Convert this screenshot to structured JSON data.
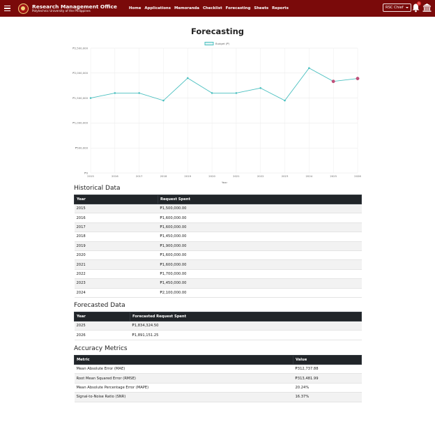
{
  "navbar": {
    "brand_title": "Research Management Office",
    "brand_subtitle": "Polytechnic University of the Philippines",
    "links": [
      "Home",
      "Applications",
      "Memoranda",
      "Checklist",
      "Forecasting",
      "Sheets",
      "Reports"
    ],
    "role": "RSC Chief",
    "notification_count": "1",
    "icons": [
      "menu-icon",
      "university-logo",
      "bell-icon",
      "building-icon"
    ]
  },
  "page": {
    "title": "Forecasting"
  },
  "chart_data": {
    "type": "line",
    "x": [
      "2015",
      "2016",
      "2017",
      "2018",
      "2019",
      "2020",
      "2021",
      "2022",
      "2023",
      "2024",
      "2025",
      "2026"
    ],
    "series": [
      {
        "name": "Budget (₱)",
        "values": [
          1500000,
          1600000,
          1600000,
          1450000,
          1900000,
          1600000,
          1600000,
          1700000,
          1450000,
          2100000,
          1834324.5,
          1891151.25
        ],
        "color": "#4bc0c0",
        "forecast_point_color": "#c0507a"
      }
    ],
    "ylim": [
      0,
      2500000
    ],
    "yticks": [
      "₱0",
      "₱500,000",
      "₱1,000,000",
      "₱1,500,000",
      "₱2,000,000",
      "₱2,500,000"
    ],
    "xlabel": "Year",
    "ylabel": "",
    "grid": true,
    "legend": "top-center"
  },
  "historical": {
    "title": "Historical Data",
    "headers": [
      "Year",
      "Request Spent"
    ],
    "rows": [
      [
        "2015",
        "₱1,500,000.00"
      ],
      [
        "2016",
        "₱1,600,000.00"
      ],
      [
        "2017",
        "₱1,600,000.00"
      ],
      [
        "2018",
        "₱1,450,000.00"
      ],
      [
        "2019",
        "₱1,900,000.00"
      ],
      [
        "2020",
        "₱1,600,000.00"
      ],
      [
        "2021",
        "₱1,600,000.00"
      ],
      [
        "2022",
        "₱1,700,000.00"
      ],
      [
        "2023",
        "₱1,450,000.00"
      ],
      [
        "2024",
        "₱2,100,000.00"
      ]
    ]
  },
  "forecasted": {
    "title": "Forecasted Data",
    "headers": [
      "Year",
      "Forecasted Request Spent"
    ],
    "rows": [
      [
        "2025",
        "₱1,834,324.50"
      ],
      [
        "2026",
        "₱1,891,151.25"
      ]
    ]
  },
  "metrics": {
    "title": "Accuracy Metrics",
    "headers": [
      "Metric",
      "Value"
    ],
    "rows": [
      [
        "Mean Absolute Error (MAE)",
        "₱312,737.88"
      ],
      [
        "Root Mean Squared Error (RMSE)",
        "₱313,481.99"
      ],
      [
        "Mean Absolute Percentage Error (MAPE)",
        "20.24%"
      ],
      [
        "Signal-to-Noise Ratio (SNR)",
        "16.37%"
      ]
    ]
  }
}
